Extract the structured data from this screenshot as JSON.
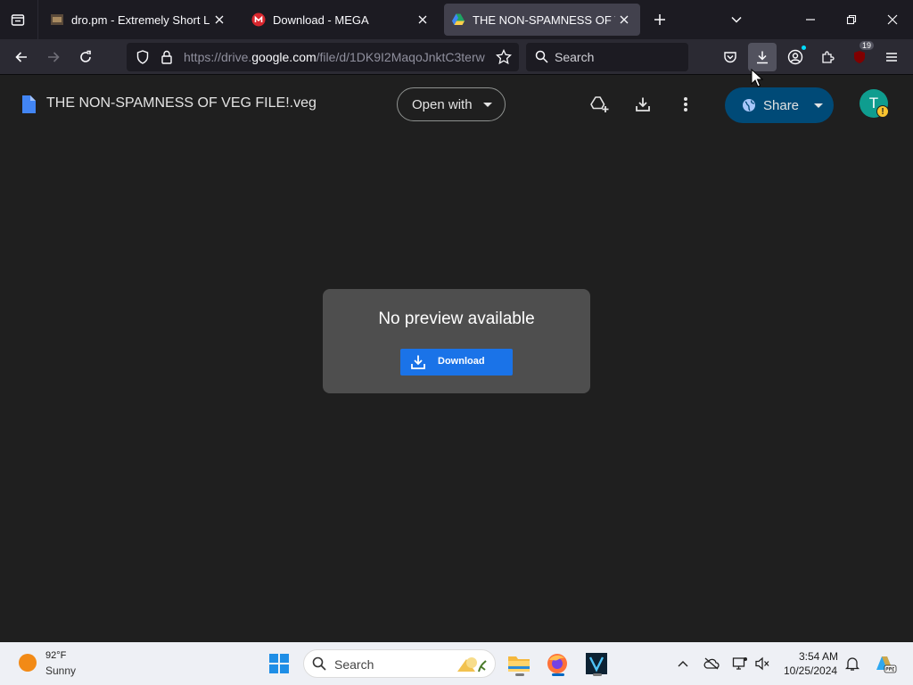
{
  "browser": {
    "tabs": [
      {
        "title": "dro.pm - Extremely Short Links",
        "favicon": "dropm-favicon",
        "active": false
      },
      {
        "title": "Download - MEGA",
        "favicon": "mega-favicon",
        "active": false
      },
      {
        "title": "THE NON-SPAMNESS OF VEG F",
        "favicon": "google-drive-favicon",
        "active": true
      }
    ],
    "url": {
      "prefix": "https://drive.",
      "domain": "google.com",
      "path": "/file/d/1DK9I2MaqoJnktC3terw"
    },
    "search_placeholder": "Search",
    "badge_count": "19"
  },
  "drive": {
    "file_name": "THE NON-SPAMNESS OF VEG FILE!.veg",
    "open_with_label": "Open with",
    "share_label": "Share",
    "avatar_letter": "T",
    "avatar_warning": "!"
  },
  "preview": {
    "message": "No preview available",
    "download_label": "Download"
  },
  "taskbar": {
    "weather_temp": "92°F",
    "weather_condition": "Sunny",
    "search_label": "Search",
    "time": "3:54 AM",
    "date": "10/25/2024"
  },
  "colors": {
    "page_bg": "#1f1f1f",
    "accent_blue": "#1a73e8",
    "share_bg": "#004a77",
    "avatar_bg": "#0f9d8f"
  }
}
